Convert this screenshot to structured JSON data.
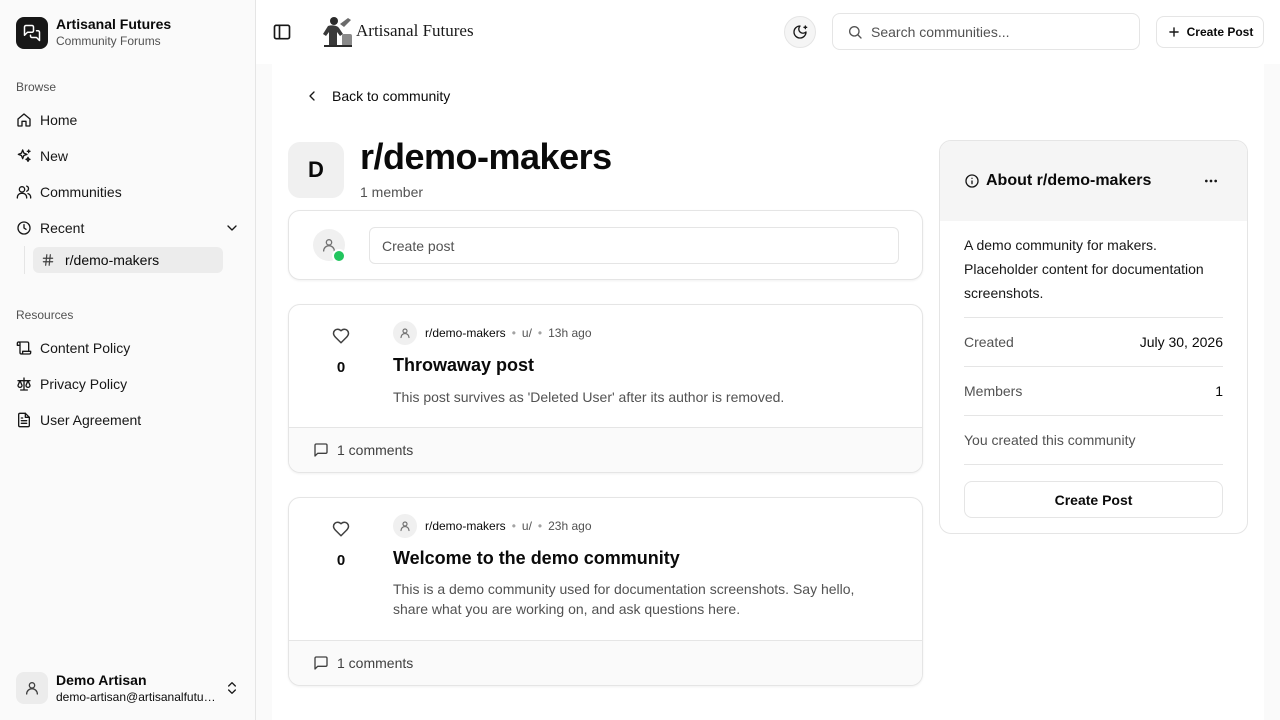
{
  "sidebar": {
    "brand_title": "Artisanal Futures",
    "brand_subtitle": "Community Forums",
    "browse_label": "Browse",
    "nav": {
      "home": "Home",
      "new": "New",
      "communities": "Communities",
      "recent": "Recent"
    },
    "recent_items": [
      "r/demo-makers"
    ],
    "resources_label": "Resources",
    "resources": {
      "content_policy": "Content Policy",
      "privacy_policy": "Privacy Policy",
      "user_agreement": "User Agreement"
    },
    "user": {
      "name": "Demo Artisan",
      "email": "demo-artisan@artisanalfutures.org"
    }
  },
  "header": {
    "site_name": "Artisanal Futures",
    "search_placeholder": "Search communities...",
    "create_post_label": "Create Post"
  },
  "community": {
    "back_label": "Back to community",
    "avatar_letter": "D",
    "title": "r/demo-makers",
    "members_text": "1 member",
    "create_placeholder": "Create post"
  },
  "posts": [
    {
      "votes": "0",
      "community": "r/demo-makers",
      "author": "u/",
      "time": "13h ago",
      "title": "Throwaway post",
      "body": "This post survives as 'Deleted User' after its author is removed.",
      "comments": "1 comments"
    },
    {
      "votes": "0",
      "community": "r/demo-makers",
      "author": "u/",
      "time": "23h ago",
      "title": "Welcome to the demo community",
      "body": "This is a demo community used for documentation screenshots. Say hello, share what you are working on, and ask questions here.",
      "comments": "1 comments"
    }
  ],
  "about": {
    "title": "About r/demo-makers",
    "description": "A demo community for makers. Placeholder content for documentation screenshots.",
    "created_label": "Created",
    "created_value": "July 30, 2026",
    "members_label": "Members",
    "members_value": "1",
    "note": "You created this community",
    "button_label": "Create Post"
  },
  "colors": {
    "online": "#22c55e",
    "brand_logo_bg": "#171717"
  },
  "icons": {
    "home": "home-icon",
    "new": "sparkles-icon",
    "communities": "users-icon",
    "recent": "clock-icon",
    "like": "heart-icon",
    "comment": "message-icon"
  }
}
